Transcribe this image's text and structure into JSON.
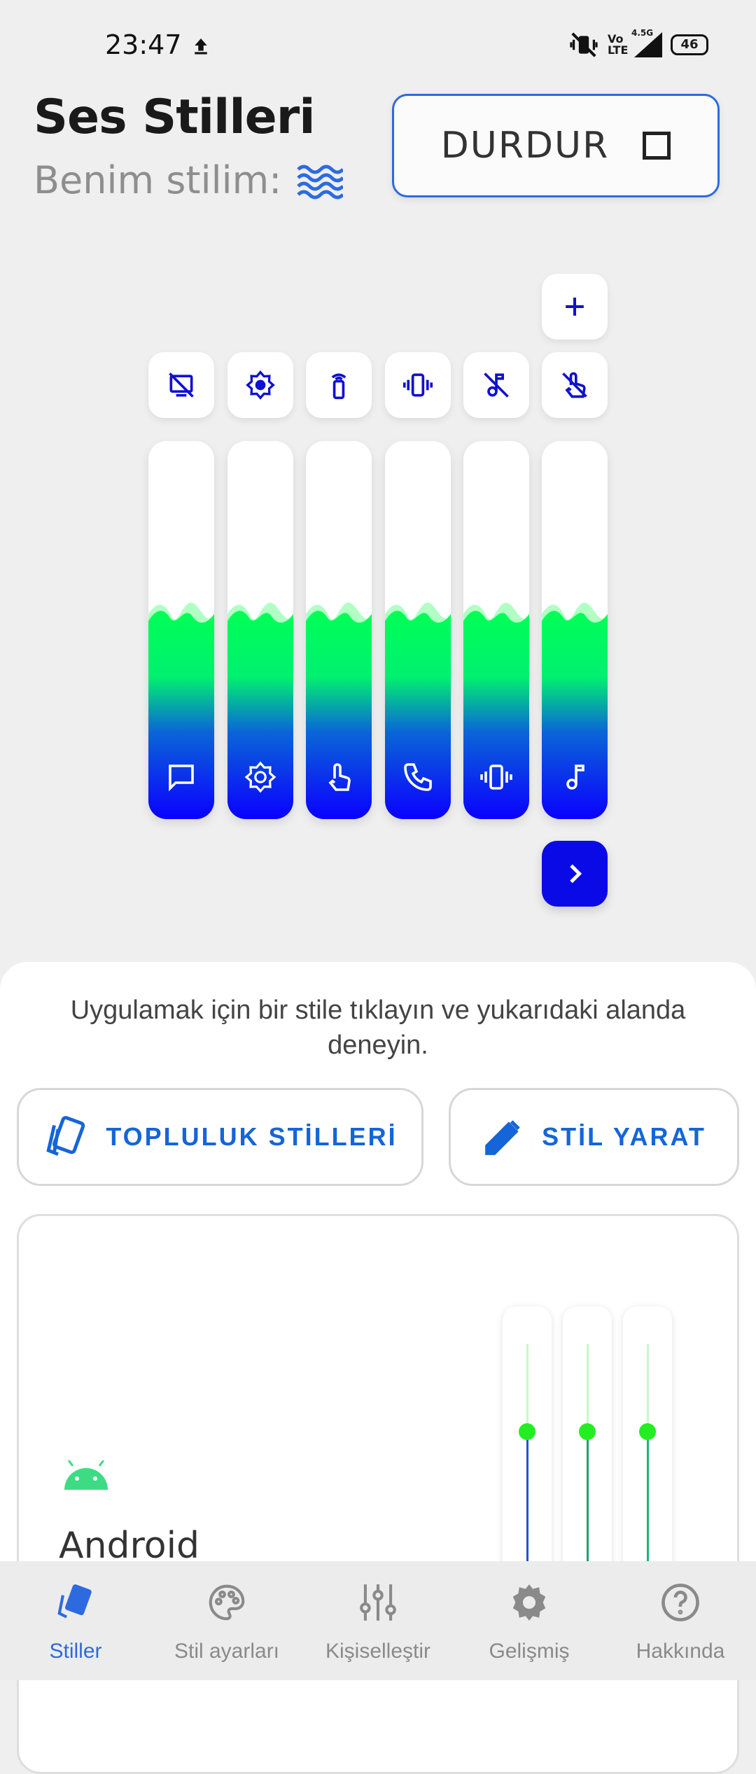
{
  "status_bar": {
    "time": "23:47",
    "network": "4.5G",
    "volte": "Vo\nLTE",
    "battery": "46"
  },
  "header": {
    "title": "Ses Stilleri",
    "subtitle": "Benim stilim:",
    "stop_label": "DURDUR"
  },
  "sound_channels": [
    {
      "top_icon": "no-screen-icon",
      "bottom_icon": "message-icon",
      "level": 0.55
    },
    {
      "top_icon": "brightness-icon",
      "bottom_icon": "brightness-icon",
      "level": 0.55
    },
    {
      "top_icon": "remote-icon",
      "bottom_icon": "touch-icon",
      "level": 0.55
    },
    {
      "top_icon": "vibration-icon",
      "bottom_icon": "phone-icon",
      "level": 0.55
    },
    {
      "top_icon": "music-off-icon",
      "bottom_icon": "vibration-icon",
      "level": 0.55
    },
    {
      "top_icon": "touch-off-icon",
      "bottom_icon": "music-note-icon",
      "level": 0.55
    }
  ],
  "sheet": {
    "hint": "Uygulamak için bir stile tıklayın ve yukarıdaki alanda deneyin.",
    "community_label": "TOPLULUK STİLLERİ",
    "create_label": "STİL YARAT",
    "card": {
      "name": "Android",
      "slider_levels": [
        0.5,
        0.5,
        0.5
      ]
    }
  },
  "nav": {
    "items": [
      {
        "label": "Stiller",
        "icon": "cards-icon",
        "active": true
      },
      {
        "label": "Stil ayarları",
        "icon": "palette-icon",
        "active": false
      },
      {
        "label": "Kişiselleştir",
        "icon": "sliders-icon",
        "active": false
      },
      {
        "label": "Gelişmiş",
        "icon": "gear-icon",
        "active": false
      },
      {
        "label": "Hakkında",
        "icon": "help-icon",
        "active": false
      }
    ]
  },
  "colors": {
    "accent": "#2d6ae0",
    "bar_top": "#00ff55",
    "bar_bottom": "#0a00ff",
    "next_button": "#0a0ae6"
  }
}
